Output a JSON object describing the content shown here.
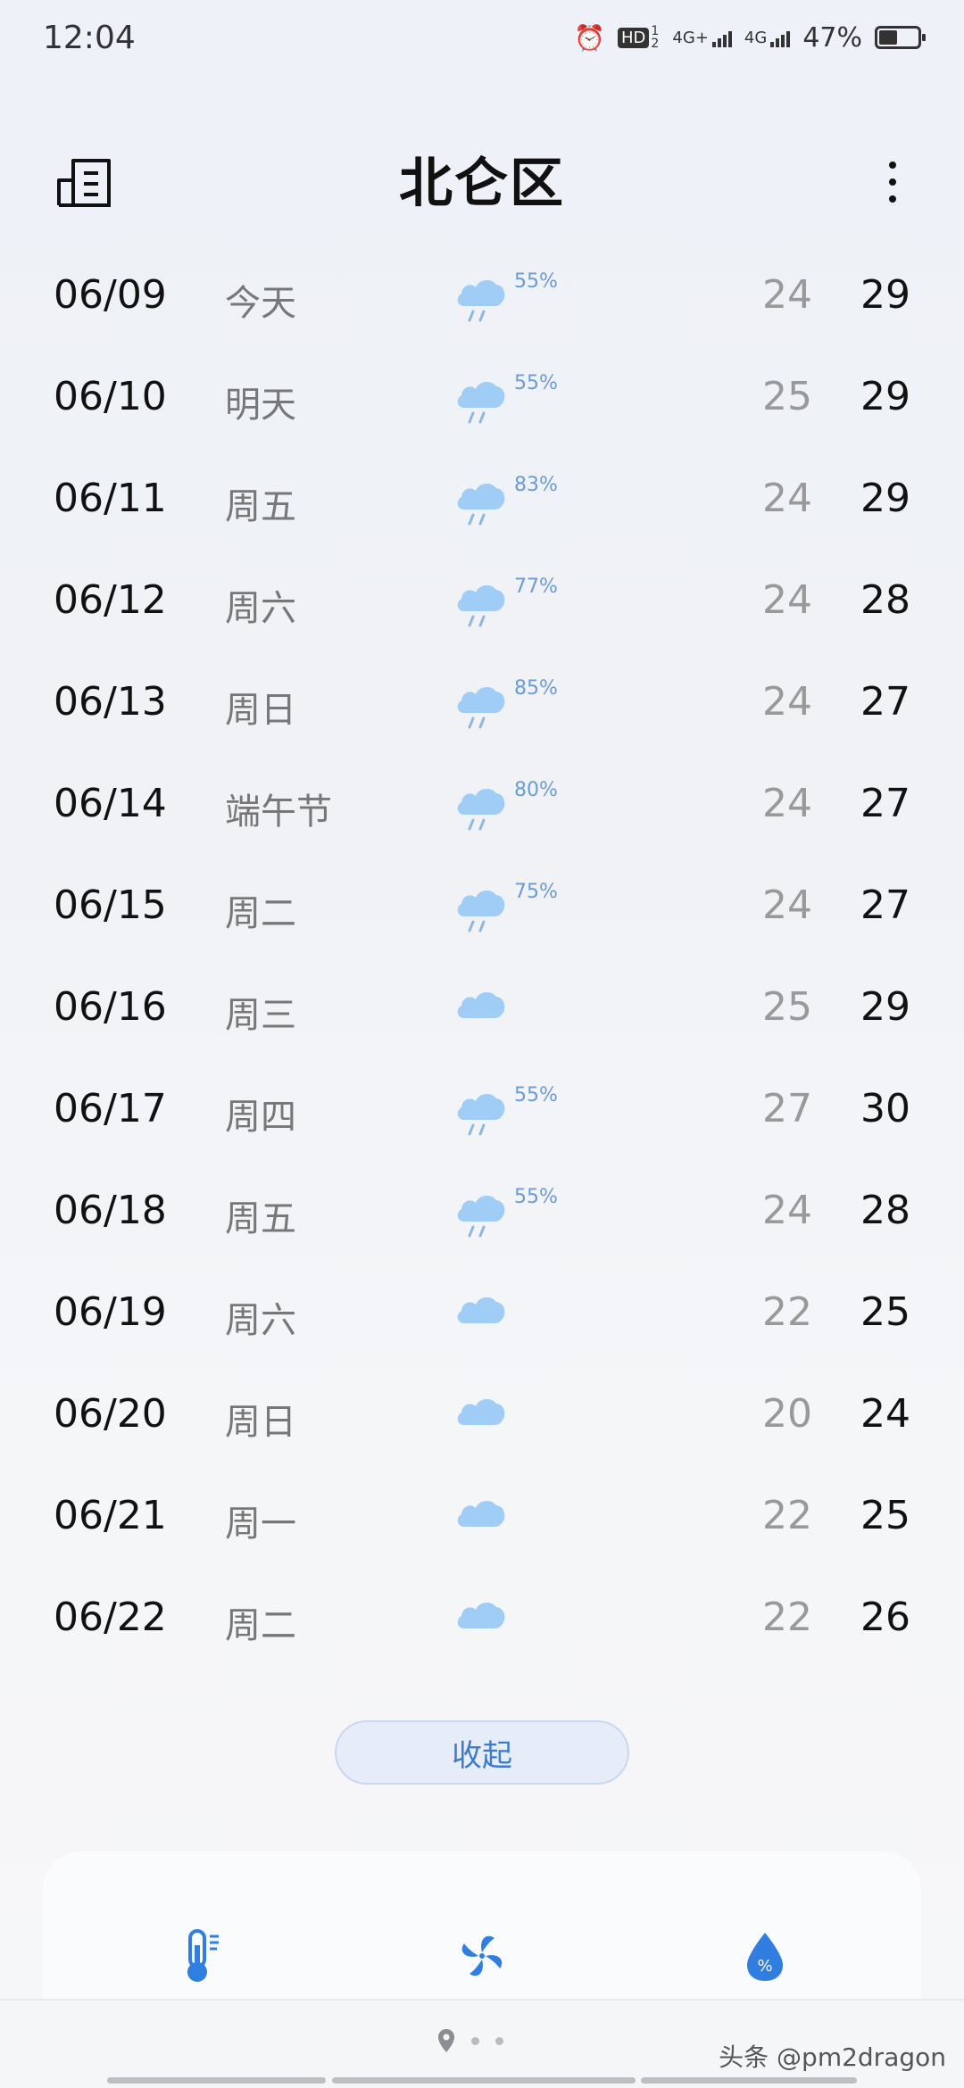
{
  "status_bar": {
    "time": "12:04",
    "hd_label": "HD",
    "hd_sub": "1 2",
    "net1": "4G+",
    "net2": "4G",
    "battery": "47%",
    "battery_level": 0.47
  },
  "header": {
    "title": "北仑区"
  },
  "forecast": [
    {
      "date": "06/09",
      "day": "今天",
      "icon": "rain-cloud-icon",
      "prob": "55%",
      "low": "24",
      "high": "29"
    },
    {
      "date": "06/10",
      "day": "明天",
      "icon": "rain-cloud-icon",
      "prob": "55%",
      "low": "25",
      "high": "29"
    },
    {
      "date": "06/11",
      "day": "周五",
      "icon": "rain-cloud-icon",
      "prob": "83%",
      "low": "24",
      "high": "29"
    },
    {
      "date": "06/12",
      "day": "周六",
      "icon": "rain-cloud-icon",
      "prob": "77%",
      "low": "24",
      "high": "28"
    },
    {
      "date": "06/13",
      "day": "周日",
      "icon": "rain-cloud-icon",
      "prob": "85%",
      "low": "24",
      "high": "27"
    },
    {
      "date": "06/14",
      "day": "端午节",
      "icon": "rain-cloud-icon",
      "prob": "80%",
      "low": "24",
      "high": "27"
    },
    {
      "date": "06/15",
      "day": "周二",
      "icon": "rain-cloud-icon",
      "prob": "75%",
      "low": "24",
      "high": "27"
    },
    {
      "date": "06/16",
      "day": "周三",
      "icon": "cloud-icon",
      "prob": "",
      "low": "25",
      "high": "29"
    },
    {
      "date": "06/17",
      "day": "周四",
      "icon": "rain-cloud-icon",
      "prob": "55%",
      "low": "27",
      "high": "30"
    },
    {
      "date": "06/18",
      "day": "周五",
      "icon": "rain-cloud-icon",
      "prob": "55%",
      "low": "24",
      "high": "28"
    },
    {
      "date": "06/19",
      "day": "周六",
      "icon": "cloud-icon",
      "prob": "",
      "low": "22",
      "high": "25"
    },
    {
      "date": "06/20",
      "day": "周日",
      "icon": "cloud-icon",
      "prob": "",
      "low": "20",
      "high": "24"
    },
    {
      "date": "06/21",
      "day": "周一",
      "icon": "cloud-icon",
      "prob": "",
      "low": "22",
      "high": "25"
    },
    {
      "date": "06/22",
      "day": "周二",
      "icon": "cloud-icon",
      "prob": "",
      "low": "22",
      "high": "26"
    }
  ],
  "collapse_label": "收起",
  "bottom_icons": [
    "thermometer-icon",
    "fan-icon",
    "humidity-drop-icon"
  ],
  "humidity_symbol": "%",
  "watermark": "头条 @pm2dragon",
  "colors": {
    "accent": "#3d7bd1",
    "cloud": "#9fcdf5",
    "prob_text": "#6c9bd6"
  }
}
